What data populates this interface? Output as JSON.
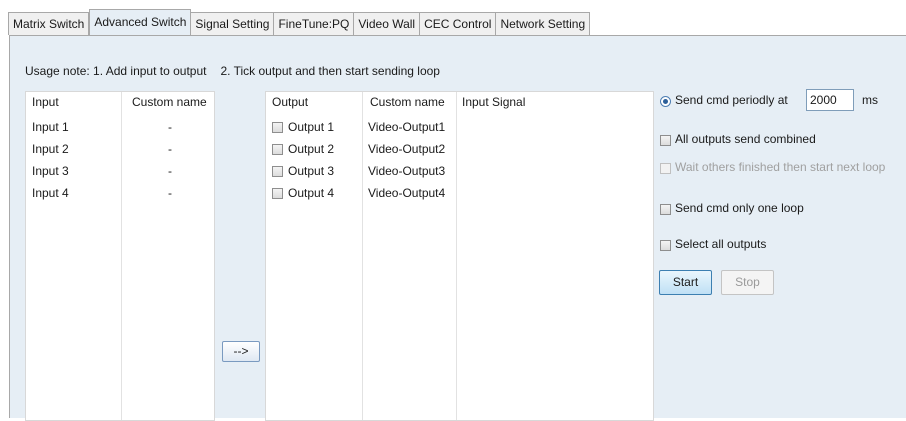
{
  "tabs": [
    {
      "label": "Matrix Switch",
      "active": false
    },
    {
      "label": "Advanced Switch",
      "active": true
    },
    {
      "label": "Signal Setting",
      "active": false
    },
    {
      "label": "FineTune:PQ",
      "active": false
    },
    {
      "label": "Video Wall",
      "active": false
    },
    {
      "label": "CEC Control",
      "active": false
    },
    {
      "label": "Network Setting",
      "active": false
    }
  ],
  "usage": {
    "part1": "Usage note: 1. Add input to output",
    "part2": "2. Tick output and then start sending loop"
  },
  "input_list": {
    "headers": [
      "Input",
      "Custom name"
    ],
    "rows": [
      {
        "name": "Input  1",
        "custom": "-"
      },
      {
        "name": "Input  2",
        "custom": "-"
      },
      {
        "name": "Input  3",
        "custom": "-"
      },
      {
        "name": "Input  4",
        "custom": "-"
      }
    ]
  },
  "add_button": {
    "label": "-->"
  },
  "output_list": {
    "headers": [
      "Output",
      "Custom name",
      "Input Signal"
    ],
    "rows": [
      {
        "name": "Output  1",
        "custom": "Video-Output1",
        "signal": "",
        "checked": false
      },
      {
        "name": "Output  2",
        "custom": "Video-Output2",
        "signal": "",
        "checked": false
      },
      {
        "name": "Output  3",
        "custom": "Video-Output3",
        "signal": "",
        "checked": false
      },
      {
        "name": "Output  4",
        "custom": "Video-Output4",
        "signal": "",
        "checked": false
      }
    ]
  },
  "options": {
    "send_periodic": {
      "label": "Send cmd periodly at",
      "value": "2000",
      "unit": "ms",
      "selected": true
    },
    "combined": {
      "label": "All outputs send combined",
      "checked": false
    },
    "wait_others": {
      "label": "Wait others finished then start next loop",
      "checked": false,
      "disabled": true
    },
    "one_loop": {
      "label": "Send cmd only one loop",
      "checked": false
    },
    "select_all": {
      "label": "Select all outputs",
      "checked": false
    }
  },
  "start_button": {
    "label": "Start"
  },
  "stop_button": {
    "label": "Stop",
    "disabled": true
  }
}
